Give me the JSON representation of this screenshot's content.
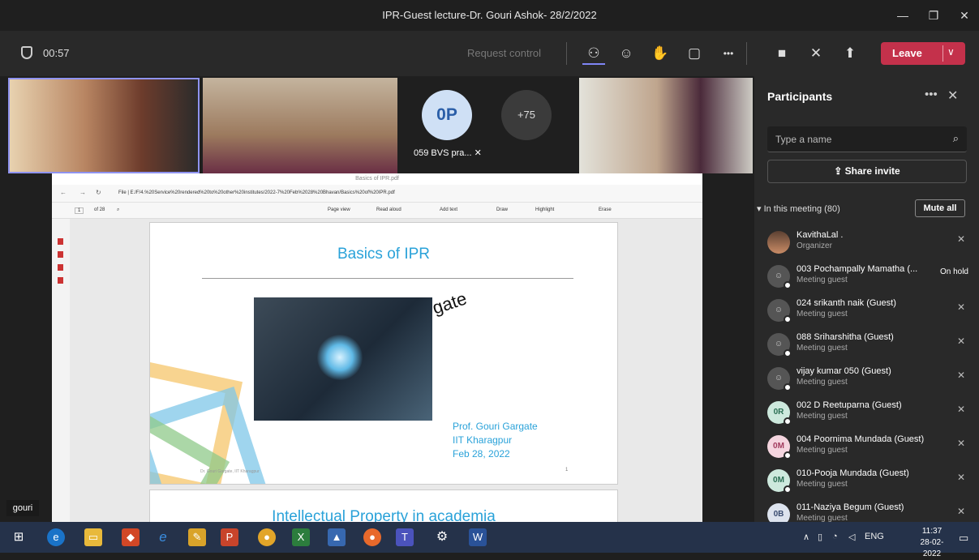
{
  "window": {
    "title": "IPR-Guest lecture-Dr. Gouri Ashok- 28/2/2022",
    "minimize": "—",
    "maximize": "❐",
    "close": "✕"
  },
  "toolbar": {
    "timer": "00:57",
    "request_control": "Request control",
    "leave": "Leave",
    "leave_chevron": "∨",
    "more": "•••"
  },
  "videos": {
    "op_initials": "0P",
    "op_name": "059 BVS pra...",
    "overflow": "+75",
    "self_name": "gouri"
  },
  "pdf": {
    "tab_title": "Basics of IPR.pdf",
    "url": "File  |  E:/F/4.%20Service%20rendered%20to%20other%20institutes/2022-7%20Feb%2028%20Bhavan/Basics%20of%20IPR.pdf",
    "page": "1",
    "of_pages": "of 28",
    "tools": [
      "Page view",
      "Read aloud",
      "Add text",
      "Draw",
      "Highlight",
      "Erase"
    ],
    "slide1": {
      "title": "Basics of IPR",
      "overlay": "rgate",
      "author": "Prof. Gouri Gargate",
      "institute": "IIT Kharagpur",
      "date": "Feb 28, 2022",
      "footer": "Dr. Gouri Gargate, IIT Kharagpur",
      "page_num": "1"
    },
    "slide2": {
      "title": "Intellectual Property in academia"
    }
  },
  "panel": {
    "title": "Participants",
    "more": "•••",
    "close": "✕",
    "search_placeholder": "Type a name",
    "share_invite": "Share invite",
    "in_meeting": "In this meeting (80)",
    "mute_all": "Mute all",
    "participants": [
      {
        "name": "KavithaLal .",
        "role": "Organizer",
        "avatar": "",
        "status": ""
      },
      {
        "name": "003 Pochampally Mamatha (...",
        "role": "Meeting guest",
        "avatar": "",
        "status": "On hold"
      },
      {
        "name": "024 srikanth naik (Guest)",
        "role": "Meeting guest",
        "avatar": "",
        "status": ""
      },
      {
        "name": "088 Sriharshitha (Guest)",
        "role": "Meeting guest",
        "avatar": "",
        "status": ""
      },
      {
        "name": "vijay kumar 050 (Guest)",
        "role": "Meeting guest",
        "avatar": "",
        "status": ""
      },
      {
        "name": "002 D Reetuparna (Guest)",
        "role": "Meeting guest",
        "avatar": "0R",
        "status": ""
      },
      {
        "name": "004 Poornima Mundada (Guest)",
        "role": "Meeting guest",
        "avatar": "0M",
        "status": ""
      },
      {
        "name": "010-Pooja Mundada (Guest)",
        "role": "Meeting guest",
        "avatar": "0M",
        "status": ""
      },
      {
        "name": "011-Naziya Begum (Guest)",
        "role": "Meeting guest",
        "avatar": "0B",
        "status": ""
      }
    ]
  },
  "taskbar": {
    "lang": "ENG",
    "time": "11:37",
    "date": "28-02-2022"
  }
}
